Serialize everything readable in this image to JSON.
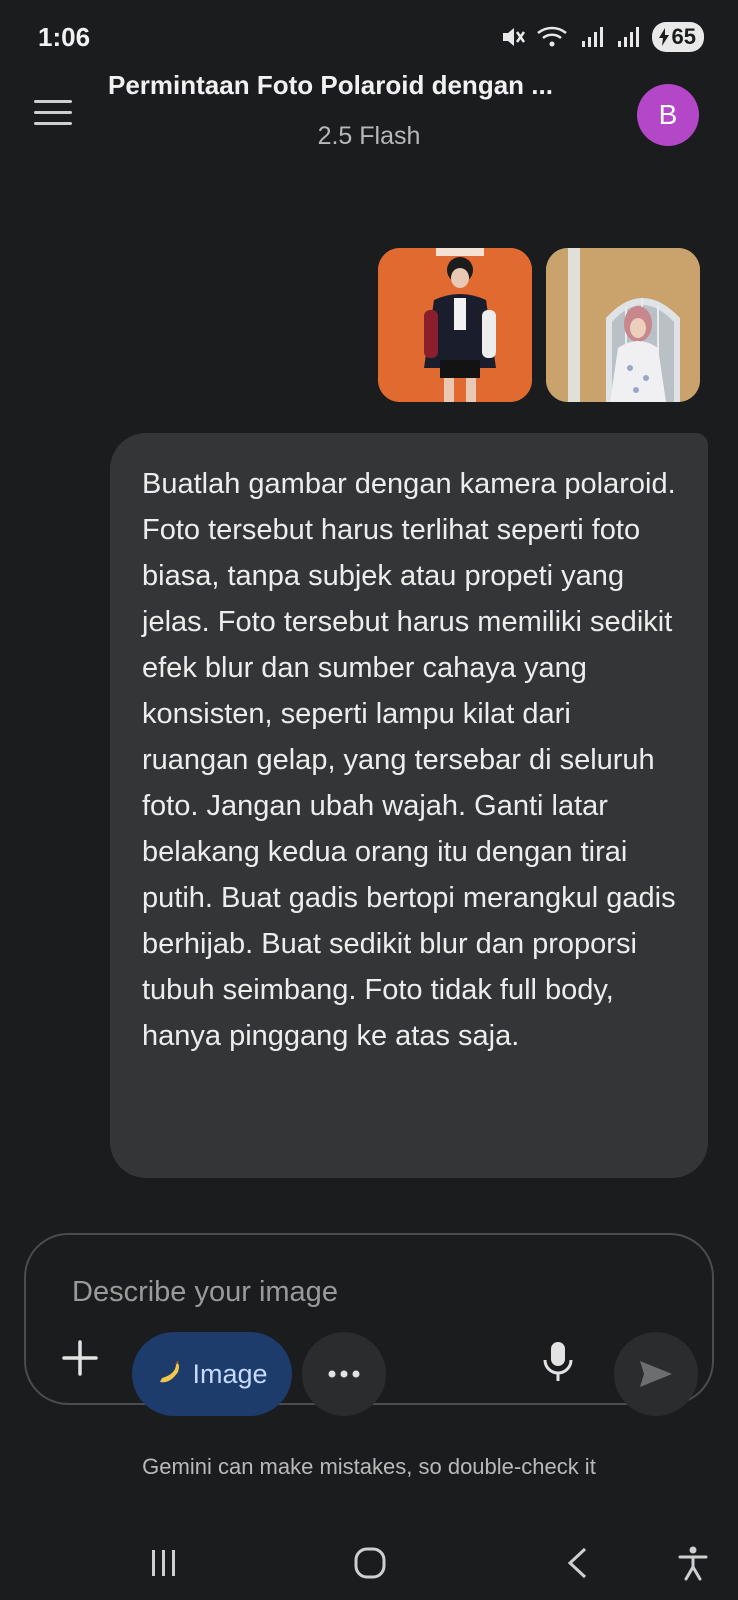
{
  "status": {
    "time": "1:06",
    "battery": "65"
  },
  "header": {
    "title": "Permintaan Foto Polaroid dengan ...",
    "model": "2.5 Flash",
    "avatar_letter": "B"
  },
  "message": {
    "text": "Buatlah gambar dengan kamera polaroid. Foto tersebut harus terlihat seperti foto biasa, tanpa subjek atau propeti yang jelas. Foto tersebut harus memiliki sedikit efek blur dan sumber cahaya yang konsisten, seperti lampu kilat dari ruangan gelap, yang tersebar di seluruh foto. Jangan ubah wajah. Ganti latar belakang kedua orang itu dengan tirai putih. Buat gadis bertopi merangkul gadis berhijab. Buat sedikit blur dan proporsi tubuh seimbang. Foto tidak full body, hanya pinggang ke atas saja."
  },
  "composer": {
    "placeholder": "Describe your image",
    "image_chip_label": "Image"
  },
  "footer": {
    "disclaimer": "Gemini can make mistakes, so double-check it"
  },
  "colors": {
    "background": "#1b1c1e",
    "bubble": "#333537",
    "avatar": "#b347c8",
    "chip": "#1d3b6b"
  },
  "icons": [
    "menu-icon",
    "mute-icon",
    "wifi-icon",
    "signal-icon",
    "battery-icon",
    "plus-icon",
    "banana-icon",
    "more-icon",
    "mic-icon",
    "send-icon",
    "recents-icon",
    "home-icon",
    "back-icon",
    "accessibility-icon"
  ]
}
